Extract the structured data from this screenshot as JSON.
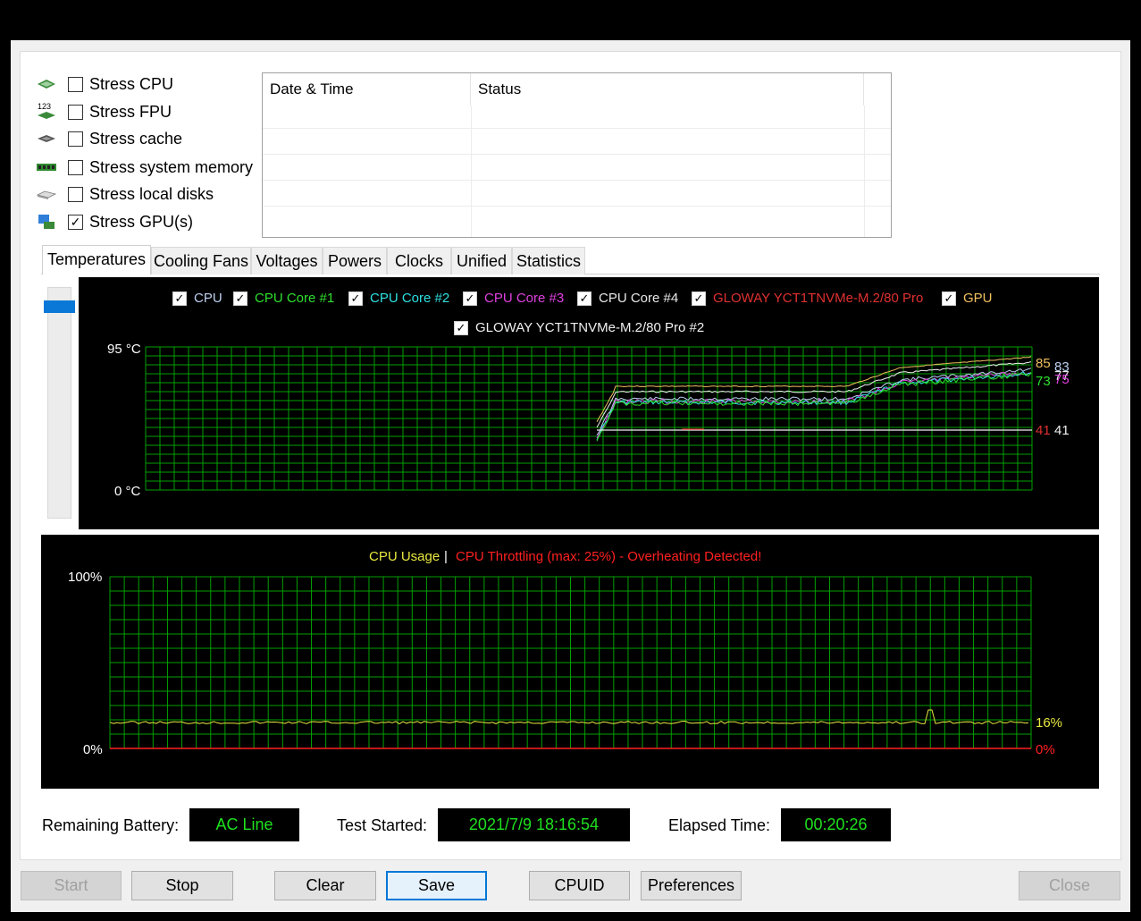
{
  "stress_options": [
    {
      "label": "Stress CPU",
      "checked": false,
      "icon": "cpu-chip-icon"
    },
    {
      "label": "Stress FPU",
      "checked": false,
      "icon": "fpu-123-icon"
    },
    {
      "label": "Stress cache",
      "checked": false,
      "icon": "cache-chip-icon"
    },
    {
      "label": "Stress system memory",
      "checked": false,
      "icon": "memory-module-icon"
    },
    {
      "label": "Stress local disks",
      "checked": false,
      "icon": "disk-drive-icon"
    },
    {
      "label": "Stress GPU(s)",
      "checked": true,
      "icon": "gpu-card-icon"
    }
  ],
  "log": {
    "columns": [
      "Date & Time",
      "Status"
    ]
  },
  "tabs": [
    "Temperatures",
    "Cooling Fans",
    "Voltages",
    "Powers",
    "Clocks",
    "Unified",
    "Statistics"
  ],
  "active_tab": "Temperatures",
  "temperature_chart": {
    "legend": [
      {
        "label": "CPU",
        "color": "#bcd0f0",
        "checked": true
      },
      {
        "label": "CPU Core #1",
        "color": "#2ee02e",
        "checked": true
      },
      {
        "label": "CPU Core #2",
        "color": "#2ee0e0",
        "checked": true
      },
      {
        "label": "CPU Core #3",
        "color": "#e040e0",
        "checked": true
      },
      {
        "label": "CPU Core #4",
        "color": "#e8e8e8",
        "checked": true
      },
      {
        "label": "GLOWAY YCT1TNVMe-M.2/80 Pro",
        "color": "#e03030",
        "checked": true
      },
      {
        "label": "GPU",
        "color": "#f0c060",
        "checked": true
      },
      {
        "label": "GLOWAY YCT1TNVMe-M.2/80 Pro #2",
        "color": "#f0f0f0",
        "checked": true
      }
    ],
    "y_max_label": "95 °C",
    "y_min_label": "0 °C",
    "current_values": [
      {
        "text": "85",
        "color": "#f0c060"
      },
      {
        "text": "83",
        "color": "#bcd0f0"
      },
      {
        "text": "77",
        "color": "#e8e8e8"
      },
      {
        "text": "75",
        "color": "#e040e0"
      },
      {
        "text": "73",
        "color": "#2ee02e"
      },
      {
        "text": "41",
        "color": "#e03030"
      },
      {
        "text": "41",
        "color": "#f0f0f0"
      }
    ]
  },
  "usage_chart": {
    "title_left": "CPU Usage",
    "separator": "|",
    "title_right": "CPU Throttling (max: 25%) - Overheating Detected!",
    "y_max_label": "100%",
    "y_min_label": "0%",
    "usage_value": "16%",
    "throttle_value": "0%",
    "colors": {
      "usage": "#e8e840",
      "throttle": "#ff2020",
      "grid": "#00a000"
    }
  },
  "status": {
    "battery_label": "Remaining Battery:",
    "battery_value": "AC Line",
    "started_label": "Test Started:",
    "started_value": "2021/7/9 18:16:54",
    "elapsed_label": "Elapsed Time:",
    "elapsed_value": "00:20:26"
  },
  "buttons": {
    "start": "Start",
    "stop": "Stop",
    "clear": "Clear",
    "save": "Save",
    "cpuid": "CPUID",
    "preferences": "Preferences",
    "close": "Close"
  }
}
